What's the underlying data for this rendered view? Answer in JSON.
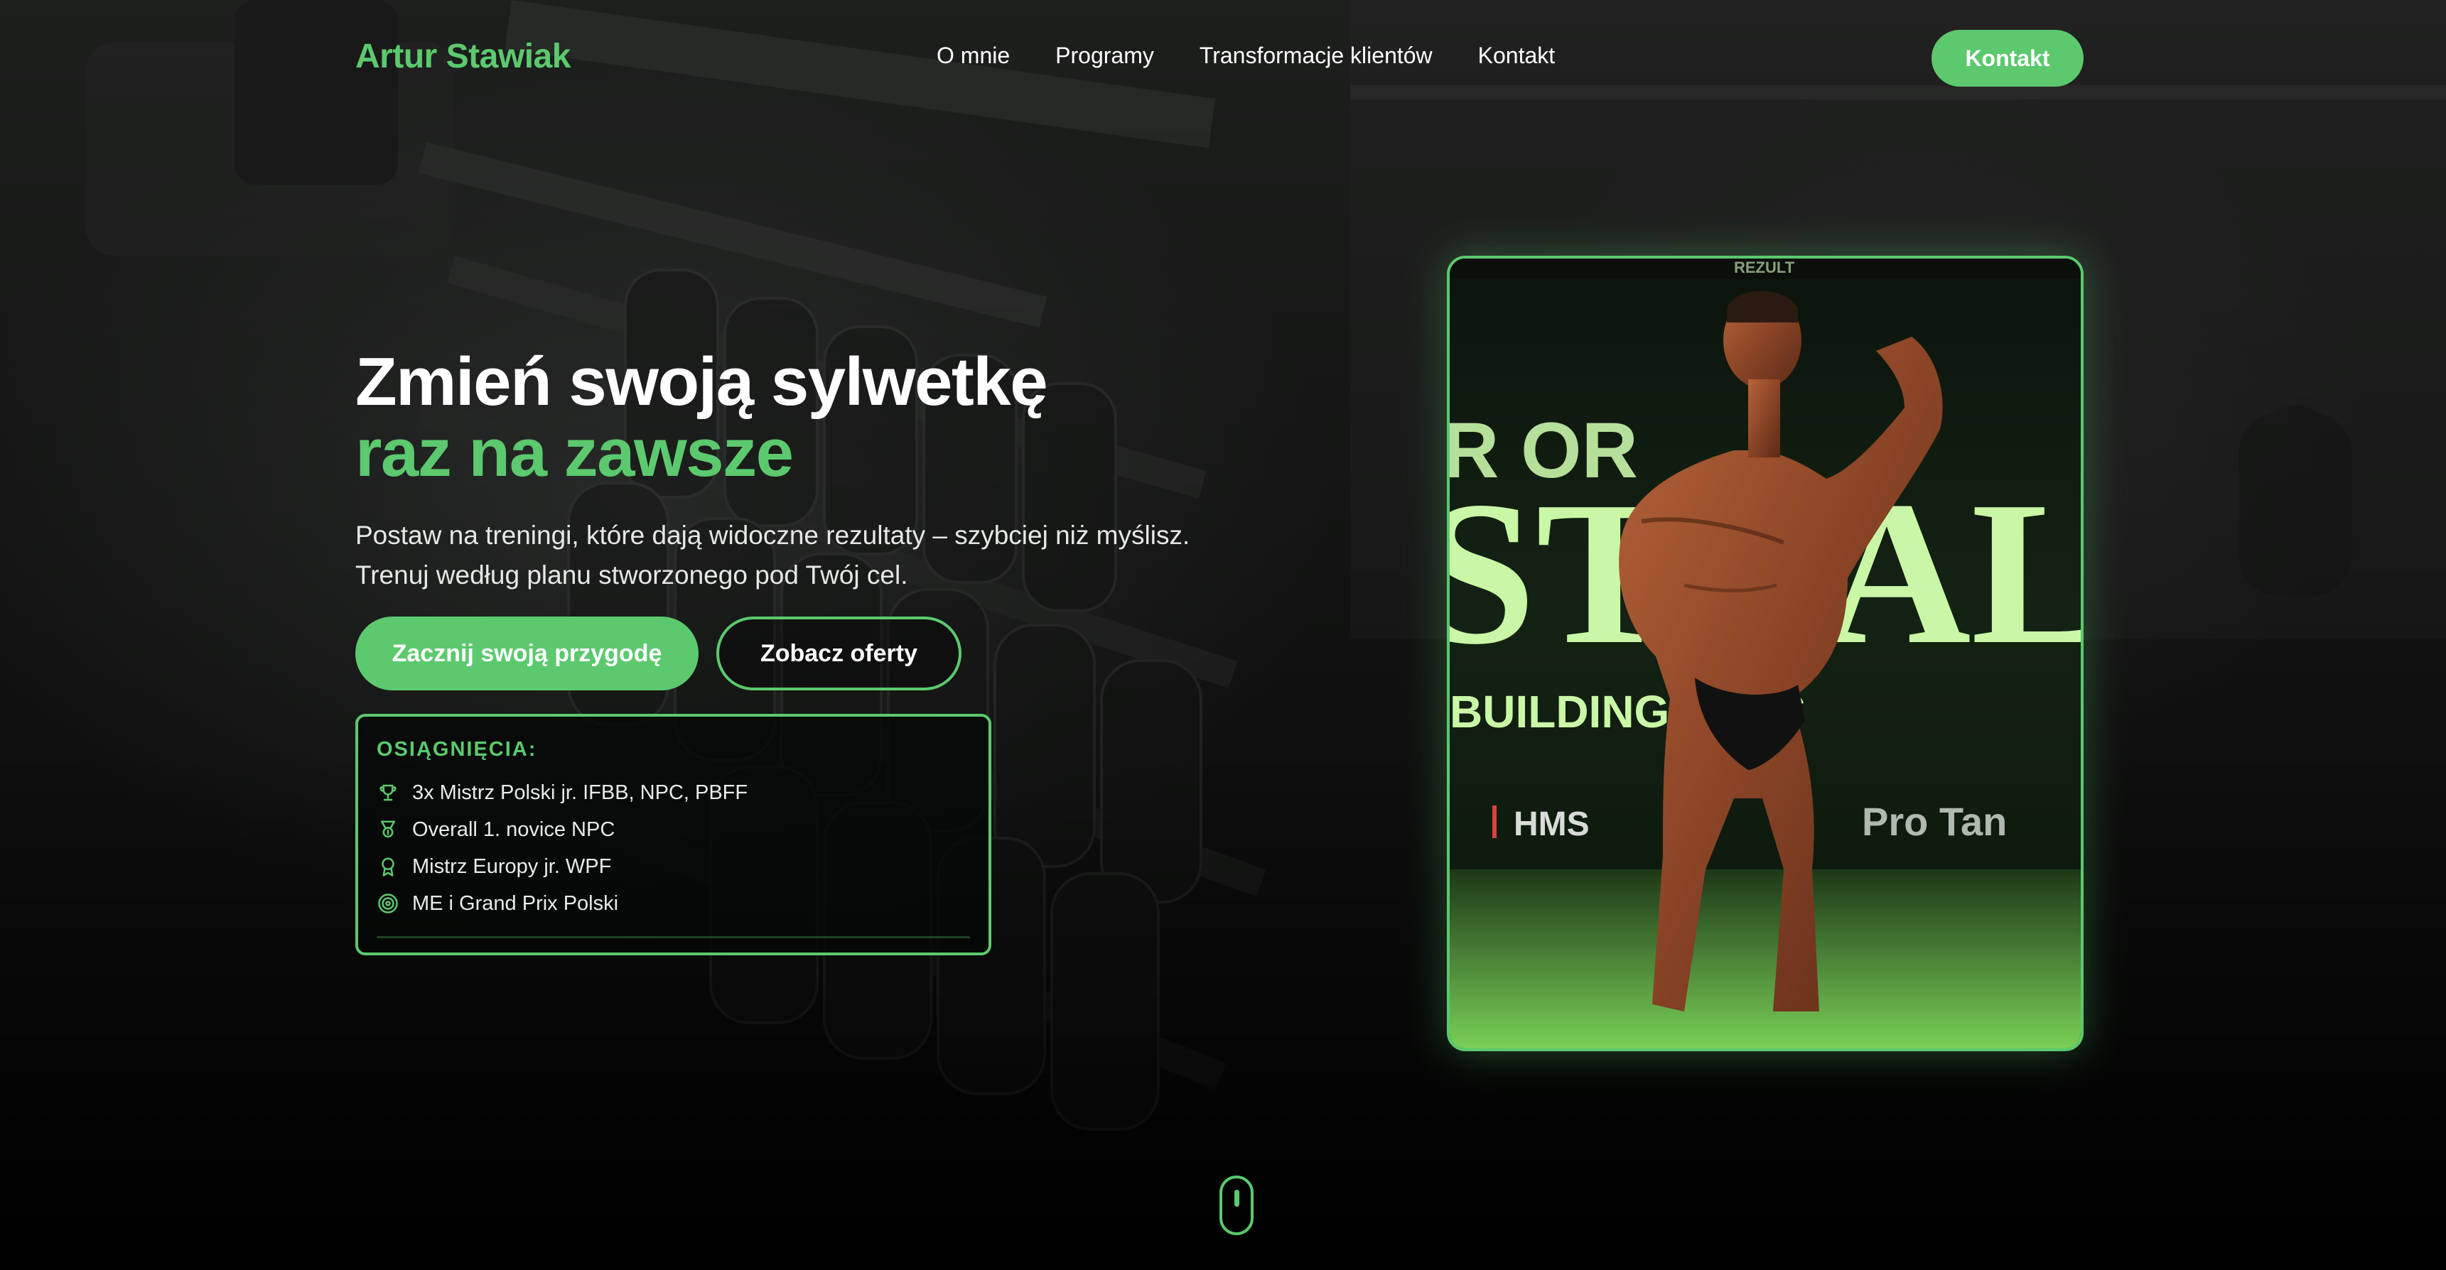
{
  "brand": {
    "name": "Artur Stawiak",
    "accent": "#5cc96e"
  },
  "nav": {
    "items": [
      "O mnie",
      "Programy",
      "Transformacje klientów",
      "Kontakt"
    ],
    "cta": "Kontakt"
  },
  "hero": {
    "title_line1": "Zmień swoją sylwetkę",
    "title_line2": "raz na zawsze",
    "subtitle_line1": "Postaw na treningi, które dają widoczne rezultaty – szybciej niż myślisz.",
    "subtitle_line2": "Trenuj według planu stworzonego pod Twój cel.",
    "primary_button": "Zacznij swoją przygodę",
    "secondary_button": "Zobacz oferty"
  },
  "achievements": {
    "title": "OSIĄGNIĘCIA:",
    "items": [
      {
        "icon": "trophy-icon",
        "label": "3x Mistrz Polski jr. IFBB, NPC, PBFF"
      },
      {
        "icon": "medal-icon",
        "label": "Overall 1. novice NPC"
      },
      {
        "icon": "award-icon",
        "label": "Mistrz Europy jr. WPF"
      },
      {
        "icon": "target-icon",
        "label": "ME i Grand Prix Polski"
      }
    ]
  },
  "photo": {
    "stage_text_top": "REZULT",
    "stage_text_main": "STRAL",
    "stage_text_row": "BUILDING   NESS",
    "sponsor_1": "HMS",
    "sponsor_2": "Pro Tan"
  },
  "scroll_indicator": {
    "icon": "mouse-scroll-icon"
  }
}
